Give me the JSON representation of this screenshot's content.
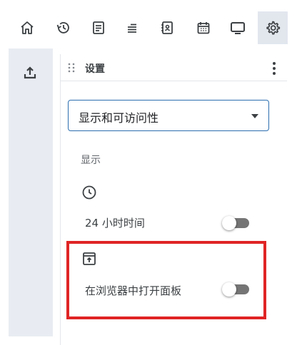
{
  "toolbar": {
    "buttons": [
      {
        "name": "home-icon"
      },
      {
        "name": "history-icon"
      },
      {
        "name": "notes-icon"
      },
      {
        "name": "list-icon"
      },
      {
        "name": "contacts-icon"
      },
      {
        "name": "calendar-icon"
      },
      {
        "name": "monitor-icon"
      },
      {
        "name": "settings-gear-icon",
        "active": true
      }
    ]
  },
  "rail": {
    "upload_icon": "upload-icon"
  },
  "panel": {
    "title": "设置",
    "category_select": {
      "value": "显示和可访问性"
    },
    "section_label": "显示",
    "clock_row": {
      "icon": "clock-icon",
      "label": "24 小时时间",
      "toggle_on": false
    },
    "browser_row": {
      "icon": "open-in-browser-icon",
      "label": "在浏览器中打开面板",
      "toggle_on": false
    }
  },
  "colors": {
    "accent_border": "#2c6fb0",
    "highlight": "#e02424",
    "rail_bg": "#e8ecf2",
    "toggle_track": "#757575"
  }
}
